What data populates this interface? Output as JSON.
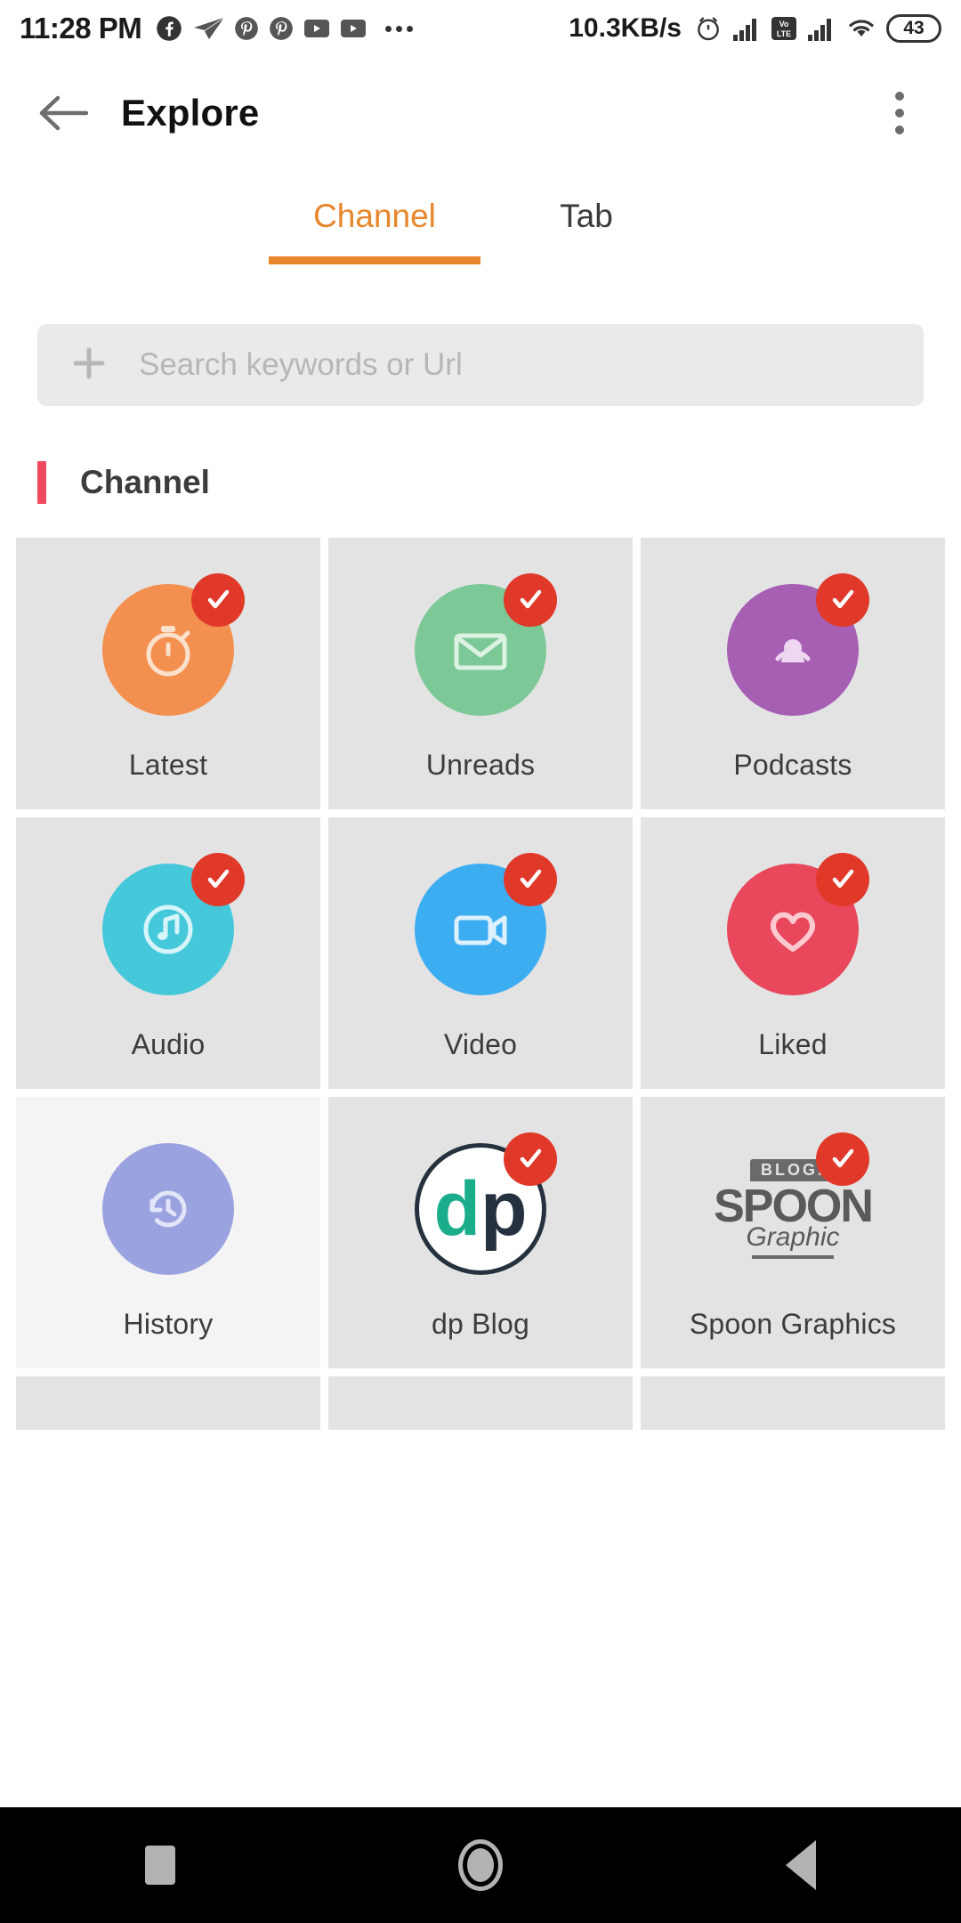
{
  "status_bar": {
    "time": "11:28 PM",
    "network_speed": "10.3KB/s",
    "battery_level": "43",
    "volte_label_top": "Vo",
    "volte_label_bottom": "LTE",
    "icons": [
      "facebook-icon",
      "paper-plane-icon",
      "pinterest-icon",
      "pinterest-icon",
      "youtube-icon",
      "youtube-icon",
      "overflow-dots-icon",
      "alarm-clock-icon",
      "signal-bars-icon",
      "volte-icon",
      "signal-bars-icon",
      "wifi-icon",
      "battery-icon"
    ]
  },
  "app_bar": {
    "title": "Explore",
    "back_icon": "back-arrow-icon",
    "overflow_icon": "overflow-menu-icon"
  },
  "tabs": [
    {
      "label": "Channel",
      "active": true
    },
    {
      "label": "Tab",
      "active": false
    }
  ],
  "search": {
    "placeholder": "Search keywords or Url",
    "value": "",
    "add_icon": "plus-icon"
  },
  "section": {
    "title": "Channel",
    "accent_color": "#EE4B5E"
  },
  "colors": {
    "accent_orange": "#E8862B",
    "badge_red": "#E0392A",
    "tile_bg": "#E3E3E3",
    "tile_bg_unselected": "#F4F4F4",
    "nav_bar_bg": "#000000"
  },
  "channels": [
    {
      "label": "Latest",
      "icon": "stopwatch-icon",
      "color": "#F3904F",
      "selected": true
    },
    {
      "label": "Unreads",
      "icon": "envelope-icon",
      "color": "#7CC896",
      "selected": true
    },
    {
      "label": "Podcasts",
      "icon": "podcast-icon",
      "color": "#A65FB3",
      "selected": true
    },
    {
      "label": "Audio",
      "icon": "music-note-icon",
      "color": "#46C8DB",
      "selected": true
    },
    {
      "label": "Video",
      "icon": "video-camera-icon",
      "color": "#3DADF2",
      "selected": true
    },
    {
      "label": "Liked",
      "icon": "heart-icon",
      "color": "#E8475C",
      "selected": true
    },
    {
      "label": "History",
      "icon": "history-icon",
      "color": "#9AA2E0",
      "selected": false
    },
    {
      "label": "dp Blog",
      "icon": "dp-blog-logo",
      "color": "#1AAD8C",
      "selected": true
    },
    {
      "label": "Spoon Graphics",
      "icon": "spoon-graphics-logo",
      "color": "#5A5A5A",
      "selected": true
    }
  ],
  "dp_blog_logo": {
    "left_letter": "d",
    "right_letter": "p"
  },
  "spoon_logo": {
    "banner": "BLOG.",
    "main": "SPOON",
    "script": "Graphic"
  },
  "nav_bar": {
    "recents_label": "recents-square",
    "home_label": "home-circle",
    "back_label": "back-triangle"
  }
}
